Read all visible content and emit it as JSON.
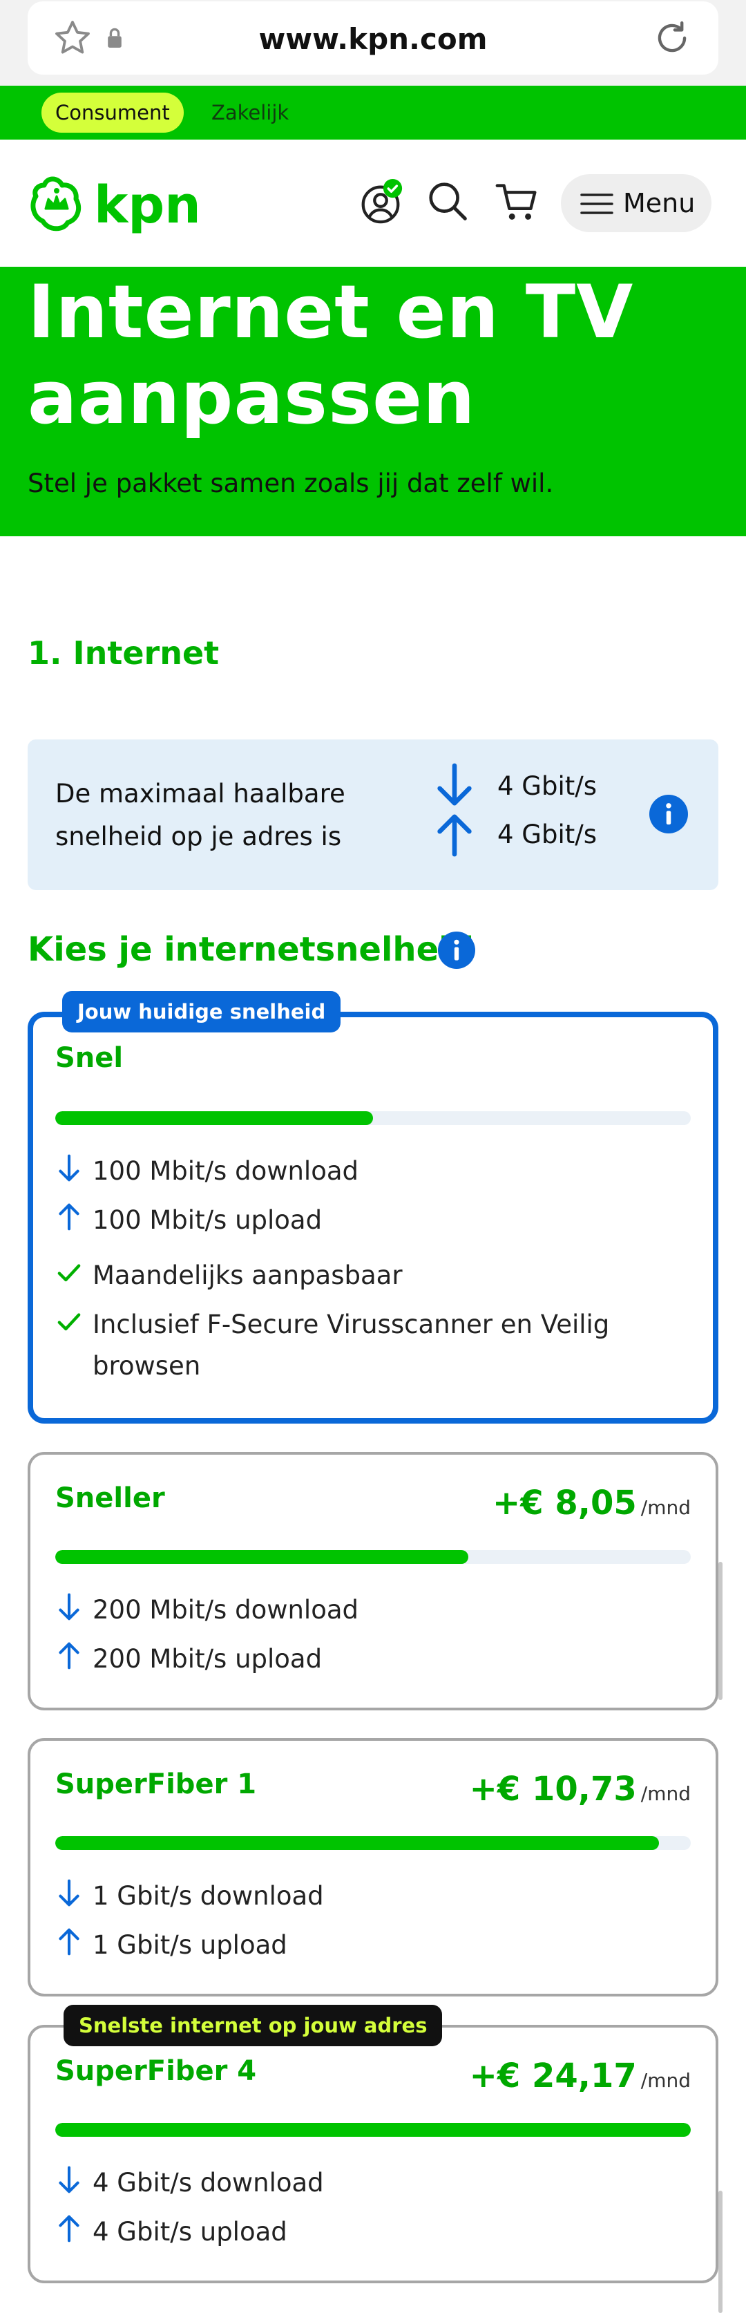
{
  "browser": {
    "url": "www.kpn.com"
  },
  "segments": {
    "active": "Consument",
    "other": "Zakelijk"
  },
  "header": {
    "logo_text": "kpn",
    "menu_label": "Menu"
  },
  "hero": {
    "title_line1": "Internet en TV",
    "title_line2": "aanpassen",
    "subtitle": "Stel je pakket samen zoals jij dat zelf wil."
  },
  "section": {
    "title": "1. Internet"
  },
  "max_speed": {
    "text_line1": "De maximaal haalbare",
    "text_line2": "snelheid op je adres is",
    "download": "4 Gbit/s",
    "upload": "4 Gbit/s"
  },
  "choose": {
    "title": "Kies je internetsnelheid"
  },
  "plans": [
    {
      "name": "Snel",
      "badge": "Jouw huidige snelheid",
      "current": true,
      "speed_fraction": 0.5,
      "download": "100 Mbit/s download",
      "upload": "100 Mbit/s upload",
      "features": [
        "Maandelijks aanpasbaar",
        "Inclusief F-Secure Virusscanner en Veilig",
        "browsen"
      ]
    },
    {
      "name": "Sneller",
      "price": "+€ 8,05",
      "unit": "/mnd",
      "speed_fraction": 0.65,
      "download": "200 Mbit/s download",
      "upload": "200 Mbit/s upload"
    },
    {
      "name": "SuperFiber 1",
      "price": "+€ 10,73",
      "unit": "/mnd",
      "speed_fraction": 0.95,
      "download": "1 Gbit/s download",
      "upload": "1 Gbit/s upload"
    },
    {
      "name": "SuperFiber 4",
      "badge": "Snelste internet op jouw adres",
      "price": "+€ 24,17",
      "unit": "/mnd",
      "speed_fraction": 1.0,
      "download": "4 Gbit/s download",
      "upload": "4 Gbit/s upload"
    }
  ],
  "colors": {
    "brand_green": "#00c300",
    "accent_blue": "#0a68d8",
    "lime": "#d4ff3a"
  }
}
